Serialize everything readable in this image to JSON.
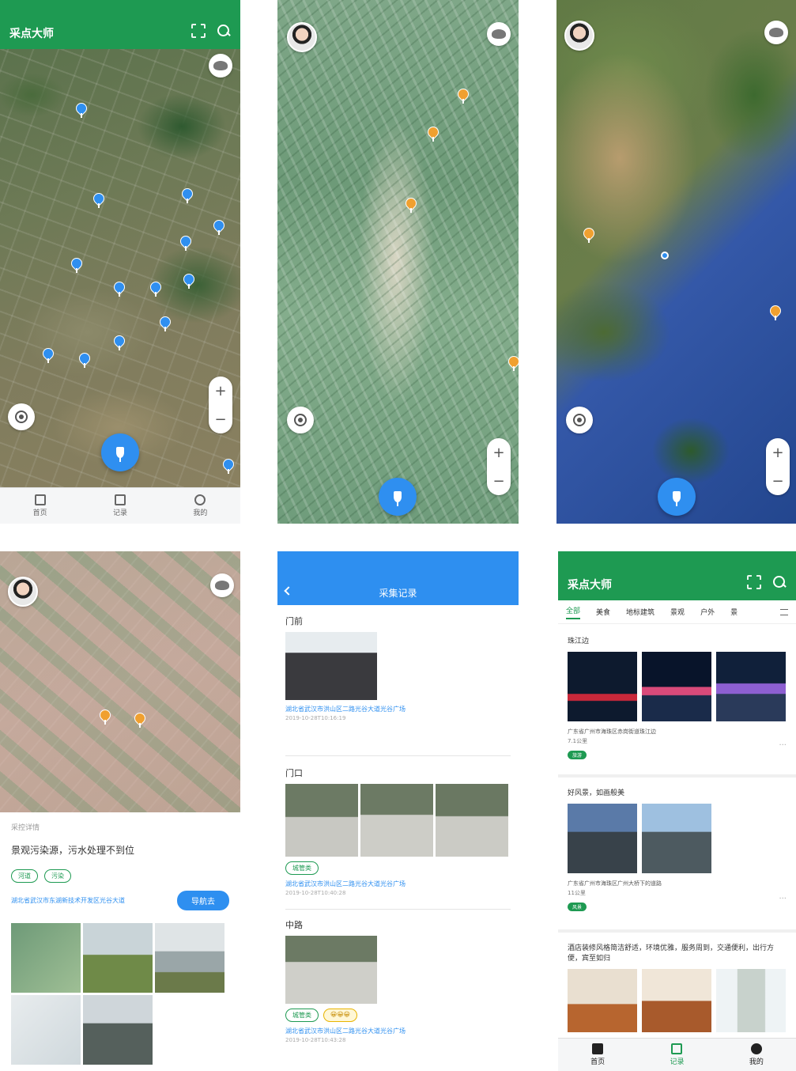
{
  "app": {
    "title": "采点大师"
  },
  "panel1": {
    "tabs": [
      {
        "label": "首页",
        "icon": "download-icon"
      },
      {
        "label": "记录",
        "icon": "document-icon"
      },
      {
        "label": "我的",
        "icon": "power-icon"
      }
    ]
  },
  "panel4": {
    "section_label": "采控详情",
    "title": "景观污染源，污水处理不到位",
    "tags": [
      "河道",
      "污染"
    ],
    "address": "湖北省武汉市东湖新技术开发区光谷大道",
    "navigate_label": "导航去"
  },
  "panel5": {
    "title": "采集记录",
    "records": [
      {
        "title": "门前",
        "address": "湖北省武汉市洪山区二路光谷大道光谷广场",
        "time": "2019-10-28T10:16:19",
        "tags": []
      },
      {
        "title": "门口",
        "address": "湖北省武汉市洪山区二路光谷大道光谷广场",
        "time": "2019-10-28T10:40:28",
        "tags": [
          "城管类"
        ]
      },
      {
        "title": "中路",
        "address": "湖北省武汉市洪山区二路光谷大道光谷广场",
        "time": "2019-10-28T10:43:28",
        "tags": [
          "城管类",
          "😀😀😀"
        ]
      }
    ]
  },
  "panel6": {
    "categories": [
      "全部",
      "美食",
      "地标建筑",
      "景观",
      "户外",
      "景"
    ],
    "cards": [
      {
        "title": "珠江边",
        "address": "广东省广州市海珠区赤岗街道珠江边",
        "sub": "7.1公里",
        "badge": "旅游"
      },
      {
        "title": "好风景，如画般美",
        "address": "广东省广州市海珠区广州大桥下的道路",
        "sub": "11公里",
        "badge": "风景"
      },
      {
        "title": "酒店装修风格简洁舒适，环境优雅，服务周到，交通便利，出行方便，宾至如归",
        "address": "",
        "sub": "",
        "badge": ""
      }
    ],
    "tabs": [
      {
        "label": "首页",
        "icon": "map-icon"
      },
      {
        "label": "记录",
        "icon": "list-icon"
      },
      {
        "label": "我的",
        "icon": "user-icon"
      }
    ]
  }
}
